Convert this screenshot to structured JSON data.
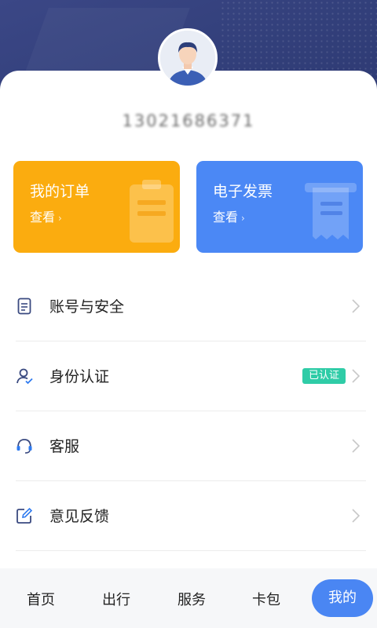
{
  "profile": {
    "avatar_icon": "user-avatar-icon",
    "phone": "13021686371"
  },
  "cards": [
    {
      "title": "我的订单",
      "action": "查看",
      "icon": "clipboard-icon",
      "color": "#fbac0f"
    },
    {
      "title": "电子发票",
      "action": "查看",
      "icon": "receipt-icon",
      "color": "#4b88f5"
    }
  ],
  "menu": [
    {
      "label": "账号与安全",
      "icon": "document-icon"
    },
    {
      "label": "身份认证",
      "icon": "user-verified-icon",
      "badge": "已认证"
    },
    {
      "label": "客服",
      "icon": "headset-icon"
    },
    {
      "label": "意见反馈",
      "icon": "edit-icon"
    }
  ],
  "tabs": [
    {
      "label": "首页"
    },
    {
      "label": "出行"
    },
    {
      "label": "服务"
    },
    {
      "label": "卡包"
    },
    {
      "label": "我的",
      "active": true
    }
  ],
  "colors": {
    "header": "#323f7a",
    "accent": "#4a86f3",
    "verified_badge": "#2fcca7"
  }
}
